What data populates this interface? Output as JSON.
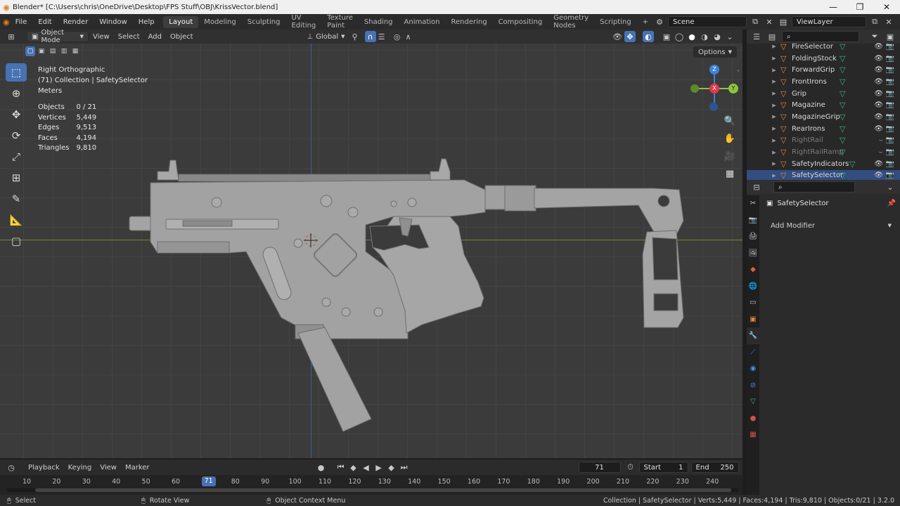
{
  "window": {
    "title": "Blender* [C:\\Users\\chris\\OneDrive\\Desktop\\FPS Stuff\\OBJ\\KrissVector.blend]",
    "minimize": "—",
    "maximize": "❐",
    "close": "✕"
  },
  "menu": [
    "File",
    "Edit",
    "Render",
    "Window",
    "Help"
  ],
  "workspaces": [
    "Layout",
    "Modeling",
    "Sculpting",
    "UV Editing",
    "Texture Paint",
    "Shading",
    "Animation",
    "Rendering",
    "Compositing",
    "Geometry Nodes",
    "Scripting"
  ],
  "workspace_add": "+",
  "scene": {
    "label": "Scene"
  },
  "viewlayer": {
    "label": "ViewLayer"
  },
  "viewport_header": {
    "mode": "Object Mode",
    "menus": [
      "View",
      "Select",
      "Add",
      "Object"
    ],
    "orientation": "Global",
    "options": "Options"
  },
  "overlay": {
    "view": "Right Orthographic",
    "collection": "(71) Collection | SafetySelector",
    "units": "Meters"
  },
  "stats": [
    {
      "label": "Objects",
      "value": "0 / 21"
    },
    {
      "label": "Vertices",
      "value": "5,449"
    },
    {
      "label": "Edges",
      "value": "9,513"
    },
    {
      "label": "Faces",
      "value": "4,194"
    },
    {
      "label": "Triangles",
      "value": "9,810"
    }
  ],
  "gizmo": {
    "z": "Z",
    "y": "Y",
    "x": "X"
  },
  "outliner": {
    "items": [
      {
        "name": "FireSelector",
        "dim": false,
        "visible": true
      },
      {
        "name": "FoldingStock",
        "dim": false,
        "visible": true
      },
      {
        "name": "ForwardGrip",
        "dim": false,
        "visible": true
      },
      {
        "name": "FrontIrons",
        "dim": false,
        "visible": true
      },
      {
        "name": "Grip",
        "dim": false,
        "visible": true
      },
      {
        "name": "Magazine",
        "dim": false,
        "visible": true
      },
      {
        "name": "MagazineGrip",
        "dim": false,
        "visible": true
      },
      {
        "name": "RearIrons",
        "dim": false,
        "visible": true
      },
      {
        "name": "RightRail",
        "dim": true,
        "visible": false
      },
      {
        "name": "RightRailRamp",
        "dim": true,
        "visible": false
      },
      {
        "name": "SafetyIndicators",
        "dim": false,
        "visible": true
      },
      {
        "name": "SafetySelector",
        "dim": false,
        "visible": true,
        "selected": true
      }
    ]
  },
  "properties": {
    "object_name": "SafetySelector",
    "add_modifier": "Add Modifier"
  },
  "timeline": {
    "menus": [
      "Playback",
      "Keying",
      "View",
      "Marker"
    ],
    "current_frame": "71",
    "start_label": "Start",
    "start": "1",
    "end_label": "End",
    "end": "250",
    "ticks": [
      "10",
      "20",
      "30",
      "40",
      "50",
      "60",
      "70",
      "80",
      "90",
      "100",
      "110",
      "120",
      "130",
      "140",
      "150",
      "160",
      "170",
      "180",
      "190",
      "200",
      "210",
      "220",
      "230",
      "240"
    ]
  },
  "status": {
    "left": "Select",
    "middle": "Rotate View",
    "right_hint": "Object Context Menu",
    "info": "Collection | SafetySelector | Verts:5,449 | Faces:4,194 | Tris:9,810 | Objects:0/21 | 3.2.0"
  },
  "colors": {
    "accent": "#4772b3",
    "object_orange": "#e08a3c",
    "mesh_green": "#3bb87b",
    "axis_x": "#e0394e",
    "axis_y": "#8bc53f",
    "axis_z": "#3d80d8"
  }
}
